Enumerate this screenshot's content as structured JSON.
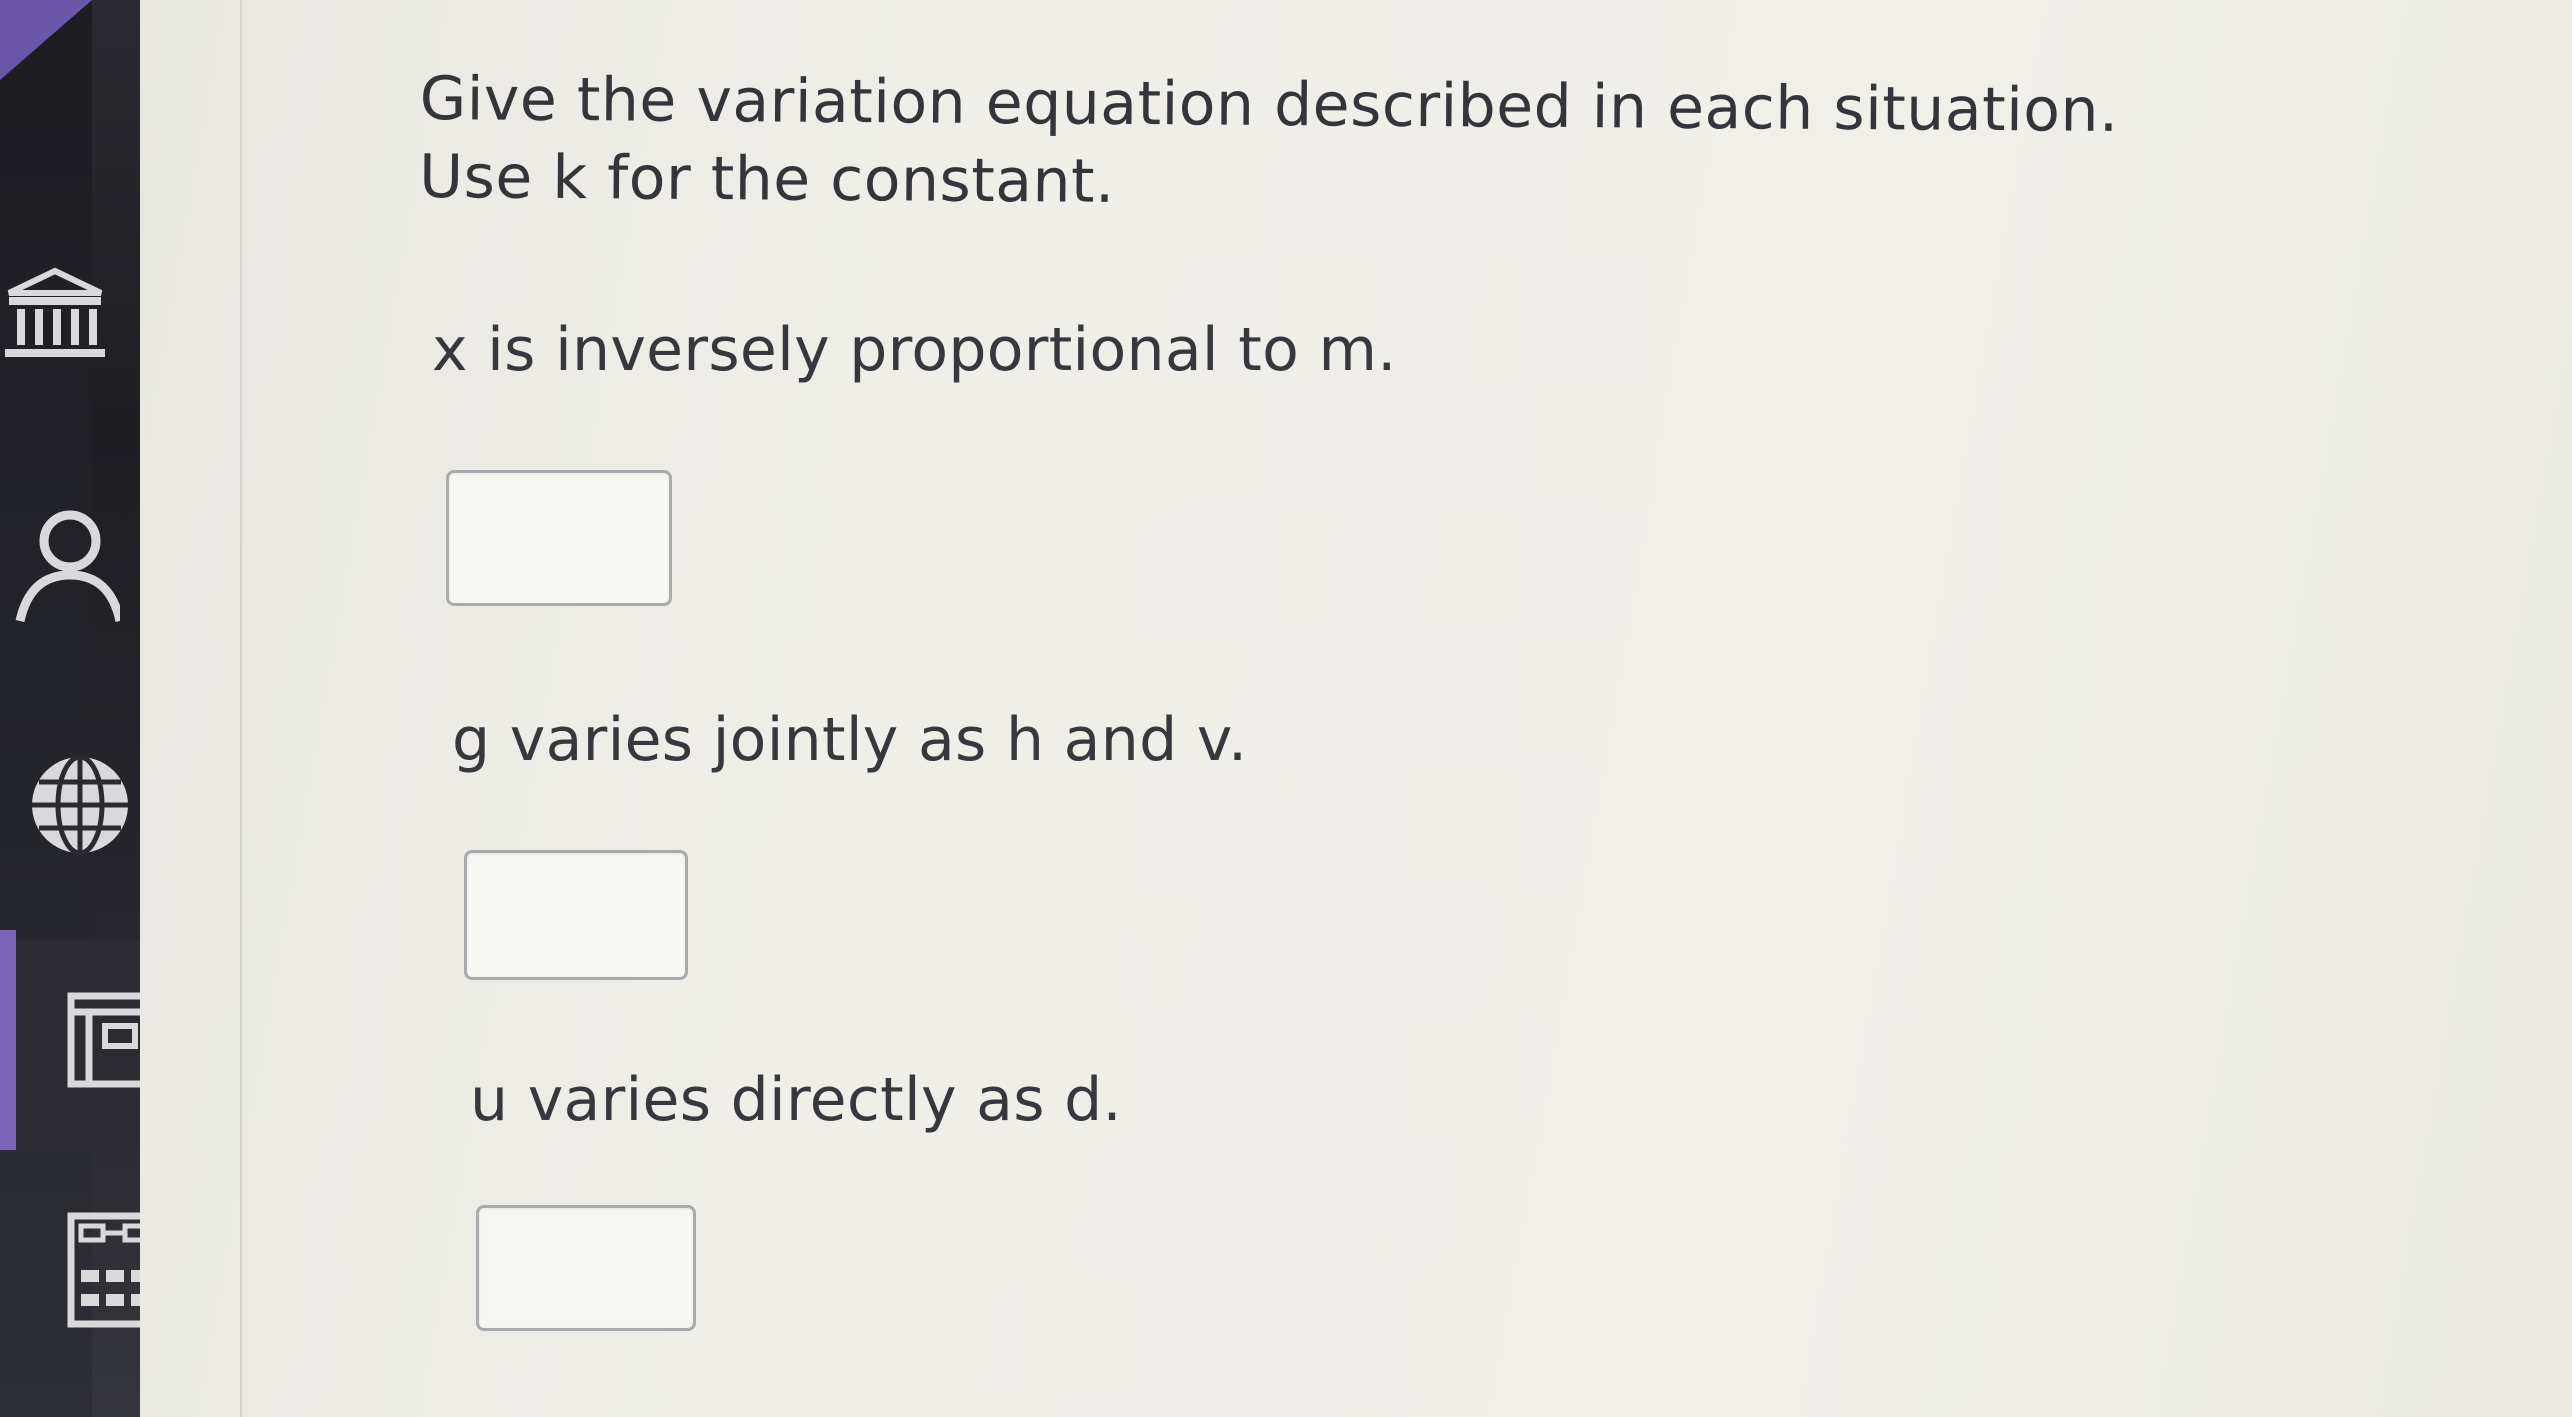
{
  "sidebar": {
    "items": [
      {
        "icon": "institution-icon"
      },
      {
        "icon": "user-icon"
      },
      {
        "icon": "globe-icon"
      },
      {
        "icon": "document-icon"
      },
      {
        "icon": "calculator-icon"
      }
    ]
  },
  "question": {
    "instruction_line1": "Give the variation equation described in each situation.",
    "instruction_line2": "Use k for the constant.",
    "parts": [
      {
        "prompt": "x is inversely proportional to m.",
        "answer": ""
      },
      {
        "prompt": "g varies jointly as h and v.",
        "answer": ""
      },
      {
        "prompt": "u varies directly as d.",
        "answer": ""
      }
    ]
  }
}
